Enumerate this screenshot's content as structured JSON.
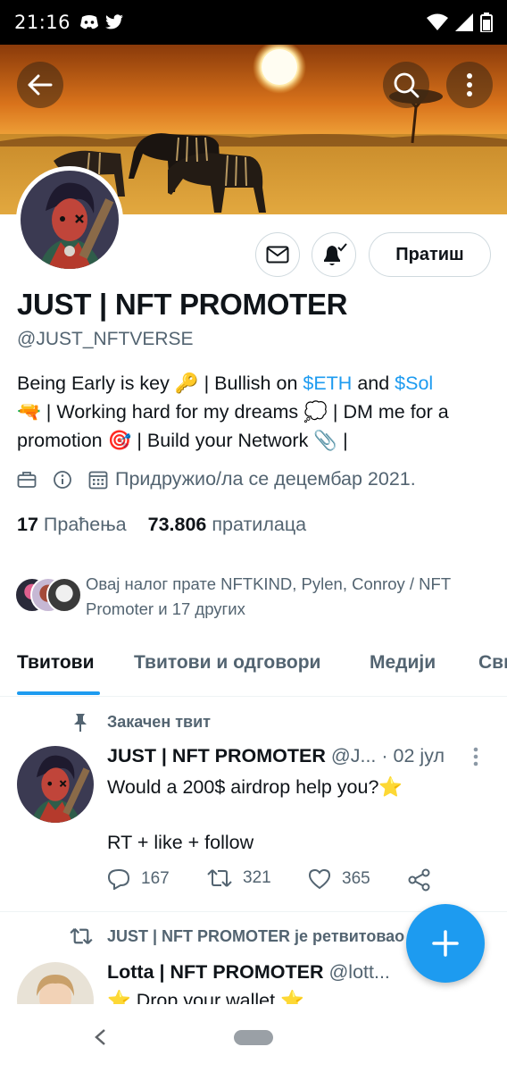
{
  "status_bar": {
    "time": "21:16"
  },
  "profile": {
    "name": "JUST | NFT PROMOTER",
    "handle": "@JUST_NFTVERSE",
    "follow_label": "Пратиш",
    "bio": {
      "p1": "Being Early is key ",
      "e1": "🔑",
      "p2": " | Bullish on ",
      "link1": "$ETH",
      "p3": " and ",
      "link2": "$Sol",
      "e2": "🔫",
      "p4": " | Working hard for my dreams ",
      "e3": "💭",
      "p5": " | DM me for a promotion ",
      "e4": "🎯",
      "p6": " | Build your Network ",
      "e5": "📎",
      "p7": " |"
    },
    "joined": "Придружио/ла се децембар 2021.",
    "following_count": "17",
    "following_label": "Праћења",
    "followers_count": "73.806",
    "followers_label": "пратилаца",
    "followed_by": "Овај налог прате NFTKIND, Pylen, Conroy / NFT Promoter и 17 других"
  },
  "tabs": [
    "Твитови",
    "Твитови и одговори",
    "Медији",
    "Свиђања"
  ],
  "pinned_tweet": {
    "pinned_label": "Закачен твит",
    "author": "JUST | NFT PROMOTER",
    "handle": "@J...",
    "date": "· 02 јул",
    "line1": "Would a 200$ airdrop help you?",
    "line1_emoji": "⭐",
    "line2": "RT + like + follow",
    "replies": "167",
    "retweets": "321",
    "likes": "365"
  },
  "retweet": {
    "label": "JUST | NFT PROMOTER је ретвитовао",
    "author": "Lotta | NFT PROMOTER",
    "handle": "@lott...",
    "text": "⭐ Drop your wallet ⭐"
  },
  "colors": {
    "accent": "#1d9bf0",
    "muted": "#536471",
    "text": "#0f1419"
  }
}
